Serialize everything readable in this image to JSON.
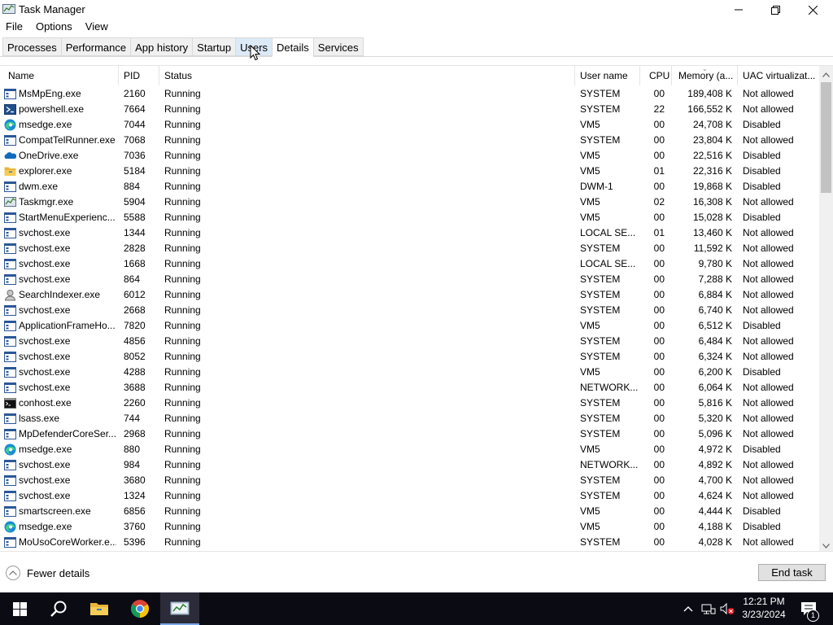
{
  "window": {
    "title": "Task Manager"
  },
  "menu": [
    "File",
    "Options",
    "View"
  ],
  "tabs": [
    {
      "label": "Processes",
      "active": false
    },
    {
      "label": "Performance",
      "active": false
    },
    {
      "label": "App history",
      "active": false
    },
    {
      "label": "Startup",
      "active": false
    },
    {
      "label": "Users",
      "active": false,
      "hover": true
    },
    {
      "label": "Details",
      "active": true
    },
    {
      "label": "Services",
      "active": false
    }
  ],
  "columns": [
    "Name",
    "PID",
    "Status",
    "User name",
    "CPU",
    "Memory (a...",
    "UAC virtualizat..."
  ],
  "processes": [
    {
      "name": "MsMpEng.exe",
      "pid": "2160",
      "status": "Running",
      "user": "SYSTEM",
      "cpu": "00",
      "mem": "189,408 K",
      "uac": "Not allowed",
      "icon": "generic"
    },
    {
      "name": "powershell.exe",
      "pid": "7664",
      "status": "Running",
      "user": "SYSTEM",
      "cpu": "22",
      "mem": "166,552 K",
      "uac": "Not allowed",
      "icon": "powershell"
    },
    {
      "name": "msedge.exe",
      "pid": "7044",
      "status": "Running",
      "user": "VM5",
      "cpu": "00",
      "mem": "24,708 K",
      "uac": "Disabled",
      "icon": "edge"
    },
    {
      "name": "CompatTelRunner.exe",
      "pid": "7068",
      "status": "Running",
      "user": "SYSTEM",
      "cpu": "00",
      "mem": "23,804 K",
      "uac": "Not allowed",
      "icon": "generic"
    },
    {
      "name": "OneDrive.exe",
      "pid": "7036",
      "status": "Running",
      "user": "VM5",
      "cpu": "00",
      "mem": "22,516 K",
      "uac": "Disabled",
      "icon": "onedrive"
    },
    {
      "name": "explorer.exe",
      "pid": "5184",
      "status": "Running",
      "user": "VM5",
      "cpu": "01",
      "mem": "22,316 K",
      "uac": "Disabled",
      "icon": "folder"
    },
    {
      "name": "dwm.exe",
      "pid": "884",
      "status": "Running",
      "user": "DWM-1",
      "cpu": "00",
      "mem": "19,868 K",
      "uac": "Disabled",
      "icon": "generic"
    },
    {
      "name": "Taskmgr.exe",
      "pid": "5904",
      "status": "Running",
      "user": "VM5",
      "cpu": "02",
      "mem": "16,308 K",
      "uac": "Not allowed",
      "icon": "taskmgr"
    },
    {
      "name": "StartMenuExperienc...",
      "pid": "5588",
      "status": "Running",
      "user": "VM5",
      "cpu": "00",
      "mem": "15,028 K",
      "uac": "Disabled",
      "icon": "generic"
    },
    {
      "name": "svchost.exe",
      "pid": "1344",
      "status": "Running",
      "user": "LOCAL SE...",
      "cpu": "01",
      "mem": "13,460 K",
      "uac": "Not allowed",
      "icon": "generic"
    },
    {
      "name": "svchost.exe",
      "pid": "2828",
      "status": "Running",
      "user": "SYSTEM",
      "cpu": "00",
      "mem": "11,592 K",
      "uac": "Not allowed",
      "icon": "generic"
    },
    {
      "name": "svchost.exe",
      "pid": "1668",
      "status": "Running",
      "user": "LOCAL SE...",
      "cpu": "00",
      "mem": "9,780 K",
      "uac": "Not allowed",
      "icon": "generic"
    },
    {
      "name": "svchost.exe",
      "pid": "864",
      "status": "Running",
      "user": "SYSTEM",
      "cpu": "00",
      "mem": "7,288 K",
      "uac": "Not allowed",
      "icon": "generic"
    },
    {
      "name": "SearchIndexer.exe",
      "pid": "6012",
      "status": "Running",
      "user": "SYSTEM",
      "cpu": "00",
      "mem": "6,884 K",
      "uac": "Not allowed",
      "icon": "search"
    },
    {
      "name": "svchost.exe",
      "pid": "2668",
      "status": "Running",
      "user": "SYSTEM",
      "cpu": "00",
      "mem": "6,740 K",
      "uac": "Not allowed",
      "icon": "generic"
    },
    {
      "name": "ApplicationFrameHo...",
      "pid": "7820",
      "status": "Running",
      "user": "VM5",
      "cpu": "00",
      "mem": "6,512 K",
      "uac": "Disabled",
      "icon": "generic"
    },
    {
      "name": "svchost.exe",
      "pid": "4856",
      "status": "Running",
      "user": "SYSTEM",
      "cpu": "00",
      "mem": "6,484 K",
      "uac": "Not allowed",
      "icon": "generic"
    },
    {
      "name": "svchost.exe",
      "pid": "8052",
      "status": "Running",
      "user": "SYSTEM",
      "cpu": "00",
      "mem": "6,324 K",
      "uac": "Not allowed",
      "icon": "generic"
    },
    {
      "name": "svchost.exe",
      "pid": "4288",
      "status": "Running",
      "user": "VM5",
      "cpu": "00",
      "mem": "6,200 K",
      "uac": "Disabled",
      "icon": "generic"
    },
    {
      "name": "svchost.exe",
      "pid": "3688",
      "status": "Running",
      "user": "NETWORK...",
      "cpu": "00",
      "mem": "6,064 K",
      "uac": "Not allowed",
      "icon": "generic"
    },
    {
      "name": "conhost.exe",
      "pid": "2260",
      "status": "Running",
      "user": "SYSTEM",
      "cpu": "00",
      "mem": "5,816 K",
      "uac": "Not allowed",
      "icon": "console"
    },
    {
      "name": "lsass.exe",
      "pid": "744",
      "status": "Running",
      "user": "SYSTEM",
      "cpu": "00",
      "mem": "5,320 K",
      "uac": "Not allowed",
      "icon": "generic"
    },
    {
      "name": "MpDefenderCoreSer...",
      "pid": "2968",
      "status": "Running",
      "user": "SYSTEM",
      "cpu": "00",
      "mem": "5,096 K",
      "uac": "Not allowed",
      "icon": "generic"
    },
    {
      "name": "msedge.exe",
      "pid": "880",
      "status": "Running",
      "user": "VM5",
      "cpu": "00",
      "mem": "4,972 K",
      "uac": "Disabled",
      "icon": "edge"
    },
    {
      "name": "svchost.exe",
      "pid": "984",
      "status": "Running",
      "user": "NETWORK...",
      "cpu": "00",
      "mem": "4,892 K",
      "uac": "Not allowed",
      "icon": "generic"
    },
    {
      "name": "svchost.exe",
      "pid": "3680",
      "status": "Running",
      "user": "SYSTEM",
      "cpu": "00",
      "mem": "4,700 K",
      "uac": "Not allowed",
      "icon": "generic"
    },
    {
      "name": "svchost.exe",
      "pid": "1324",
      "status": "Running",
      "user": "SYSTEM",
      "cpu": "00",
      "mem": "4,624 K",
      "uac": "Not allowed",
      "icon": "generic"
    },
    {
      "name": "smartscreen.exe",
      "pid": "6856",
      "status": "Running",
      "user": "VM5",
      "cpu": "00",
      "mem": "4,444 K",
      "uac": "Disabled",
      "icon": "generic"
    },
    {
      "name": "msedge.exe",
      "pid": "3760",
      "status": "Running",
      "user": "VM5",
      "cpu": "00",
      "mem": "4,188 K",
      "uac": "Disabled",
      "icon": "edge"
    },
    {
      "name": "MoUsoCoreWorker.e...",
      "pid": "5396",
      "status": "Running",
      "user": "SYSTEM",
      "cpu": "00",
      "mem": "4,028 K",
      "uac": "Not allowed",
      "icon": "generic"
    }
  ],
  "footer": {
    "fewer_details": "Fewer details",
    "end_task": "End task"
  },
  "taskbar": {
    "items": [
      "start-icon",
      "search-icon",
      "file-explorer-icon",
      "chrome-icon",
      "task-manager-icon"
    ],
    "time": "12:21 PM",
    "date": "3/23/2024",
    "notification_count": "1"
  },
  "colors": {
    "taskbar": "#0b0b14",
    "accent": "#7aa7e8",
    "tab_hover": "#dceaf7"
  }
}
